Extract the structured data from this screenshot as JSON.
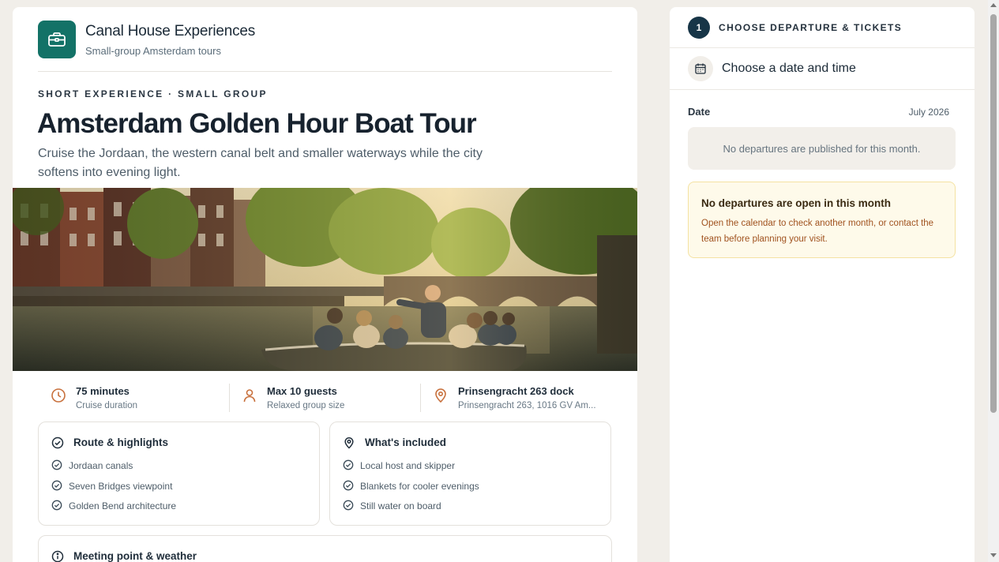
{
  "brand": {
    "name": "Canal House Experiences",
    "tagline": "Small-group Amsterdam tours",
    "icon": "briefcase-icon"
  },
  "tour": {
    "eyebrow": "SHORT EXPERIENCE · SMALL GROUP",
    "title": "Amsterdam Golden Hour Boat Tour",
    "description": "Cruise the Jordaan, the western canal belt and smaller waterways while the city softens into evening light."
  },
  "facts": [
    {
      "icon": "clock-icon",
      "title": "75 minutes",
      "subtitle": "Cruise duration"
    },
    {
      "icon": "person-icon",
      "title": "Max 10 guests",
      "subtitle": "Relaxed group size"
    },
    {
      "icon": "location-pin-icon",
      "title": "Prinsengracht 263 dock",
      "subtitle": "Prinsengracht 263, 1016 GV Am..."
    }
  ],
  "route": {
    "title": "Route & highlights",
    "items": [
      "Jordaan canals",
      "Seven Bridges viewpoint",
      "Golden Bend architecture"
    ]
  },
  "included": {
    "title": "What's included",
    "items": [
      "Local host and skipper",
      "Blankets for cooler evenings",
      "Still water on board"
    ]
  },
  "meeting": {
    "title": "Meeting point & weather"
  },
  "booking": {
    "step_number": "1",
    "step_label": "CHOOSE DEPARTURE & TICKETS",
    "choose_label": "Choose a date and time",
    "date_label": "Date",
    "month": "July 2026",
    "empty_message": "No departures are published for this month.",
    "warning_title": "No departures are open in this month",
    "warning_text": "Open the calendar to check another month, or contact the team before planning your visit."
  },
  "colors": {
    "brand_teal": "#137267",
    "accent_orange": "#c8703c",
    "navy": "#173547",
    "warning_bg": "#fefaea",
    "warning_text": "#a0521f"
  }
}
